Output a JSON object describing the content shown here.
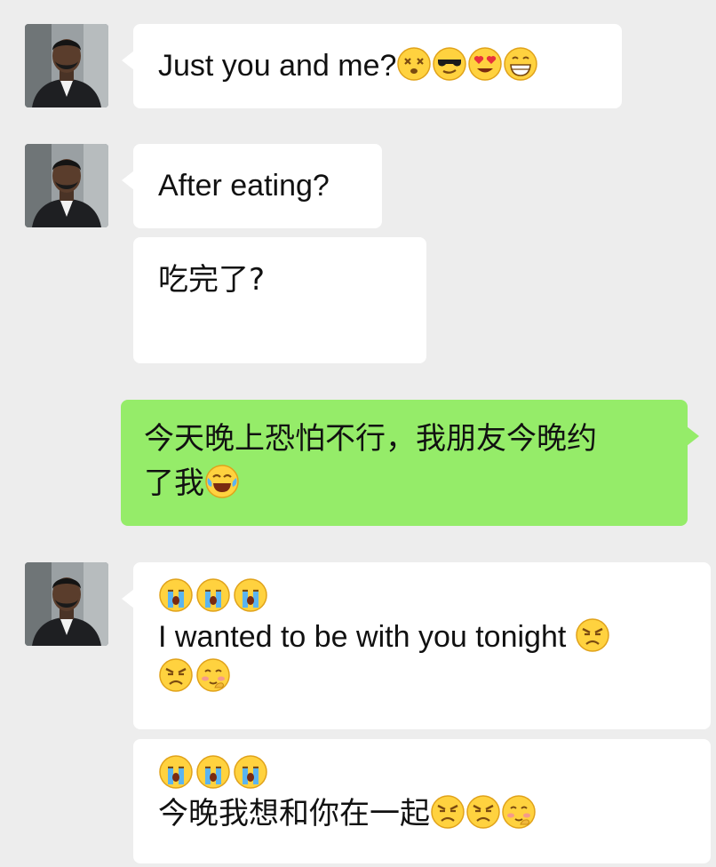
{
  "chat": {
    "messages": [
      {
        "sender": "contact",
        "text": "Just you and me?",
        "emojis": [
          "dizzy-face-emoji",
          "sunglasses-face-emoji",
          "heart-eyes-face-emoji",
          "grinning-face-emoji"
        ]
      },
      {
        "sender": "contact",
        "text": "After eating?"
      },
      {
        "sender": "contact",
        "text": "吃完了?"
      },
      {
        "sender": "self",
        "text_line1": "今天晚上恐怕不行，我朋友今晚约",
        "text_line2": "了我",
        "emojis": [
          "tears-of-joy-emoji"
        ]
      },
      {
        "sender": "contact",
        "lead_emojis": [
          "crying-face-emoji",
          "crying-face-emoji",
          "crying-face-emoji"
        ],
        "text": "I wanted to be with you tonight",
        "emojis": [
          "angry-face-emoji",
          "angry-face-emoji",
          "shy-face-emoji"
        ]
      },
      {
        "sender": "contact",
        "lead_emojis": [
          "crying-face-emoji",
          "crying-face-emoji",
          "crying-face-emoji"
        ],
        "text": "今晚我想和你在一起",
        "emojis": [
          "angry-face-emoji",
          "angry-face-emoji",
          "shy-face-emoji"
        ]
      }
    ]
  },
  "colors": {
    "background": "#ededed",
    "incoming_bubble": "#ffffff",
    "outgoing_bubble": "#95ec69",
    "text": "#111111"
  }
}
